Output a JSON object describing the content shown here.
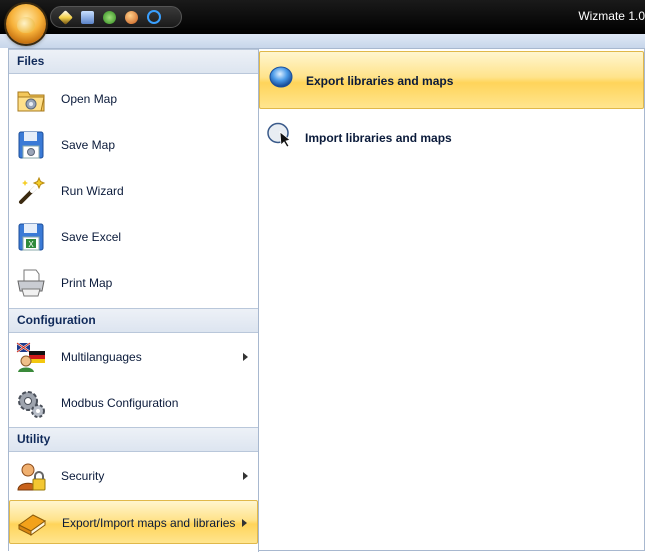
{
  "window": {
    "title": "Wizmate 1.0"
  },
  "quick_access": [
    {
      "icon": "magic-wand-icon"
    },
    {
      "icon": "save-icon"
    },
    {
      "icon": "green-person-icon"
    },
    {
      "icon": "users-icon"
    },
    {
      "icon": "refresh-ring-icon"
    }
  ],
  "menu": {
    "groups": {
      "files": "Files",
      "configuration": "Configuration",
      "utility": "Utility"
    },
    "items": {
      "open_map": "Open Map",
      "save_map": "Save Map",
      "run_wizard": "Run Wizard",
      "save_excel": "Save Excel",
      "print_map": "Print Map",
      "multilanguages": "Multilanguages",
      "modbus_configuration": "Modbus Configuration",
      "security": "Security",
      "export_import": "Export/Import maps and libraries"
    }
  },
  "submenu": {
    "export": "Export libraries and maps",
    "import": "Import libraries and maps"
  },
  "colors": {
    "highlight": "#ffd45a",
    "header_text": "#102a5a",
    "titlebar": "#000000"
  }
}
